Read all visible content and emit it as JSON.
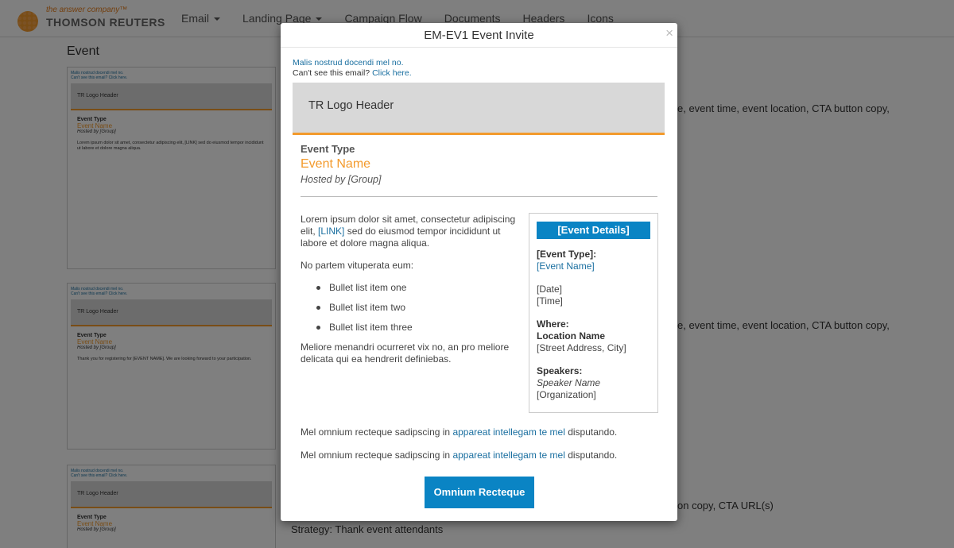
{
  "nav": {
    "logo_tagline": "the answer company™",
    "logo_name": "THOMSON REUTERS",
    "items": [
      {
        "label": "Email",
        "dropdown": true
      },
      {
        "label": "Landing Page",
        "dropdown": true
      },
      {
        "label": "Campaign Flow",
        "dropdown": false
      },
      {
        "label": "Documents",
        "dropdown": false
      },
      {
        "label": "Headers",
        "dropdown": false
      },
      {
        "label": "Icons",
        "dropdown": false
      }
    ]
  },
  "background": {
    "page_title": "Event",
    "side_texts": [
      "e, event time, event location, CTA button copy,",
      "e, event time, event location, CTA button copy,",
      "on copy, CTA URL(s)",
      "Strategy: Thank event attendants"
    ],
    "thumb_preheader_1": "Malis nostrud docendi mel no.",
    "thumb_preheader_2": "Can't see this email? Click here.",
    "thumb_header": "TR Logo Header",
    "thumb_event_type": "Event Type",
    "thumb_event_name": "Event Name",
    "thumb_hosted": "Hosted by [Group]",
    "thumb_body_1": "Lorem ipsum dolor sit amet, consectetur adipiscing elit, [LINK] sed do eiusmod tempor incididunt ut labore et dolore magna aliqua.",
    "thumb_body_2": "Thank you for registering for [EVENT NAME]. We are looking forward to your participation."
  },
  "modal": {
    "title": "EM-EV1 Event Invite",
    "close": "×",
    "preheader_line1": "Malis nostrud docendi mel no.",
    "preheader_line2_text": "Can't see this email? ",
    "preheader_line2_link": "Click here.",
    "logo_header": "TR Logo Header",
    "event_type": "Event Type",
    "event_name": "Event Name",
    "hosted_by": "Hosted by [Group]",
    "body_para1_a": "Lorem ipsum dolor sit amet, consectetur adipiscing elit, ",
    "body_para1_link": "[LINK]",
    "body_para1_b": " sed do eiusmod tempor incididunt ut labore et dolore magna aliqua.",
    "body_para2": "No partem vituperata eum:",
    "bullets": [
      "Bullet list item one",
      "Bullet list item two",
      "Bullet list item three"
    ],
    "body_para3": "Meliore menandri ocurreret vix no, an pro meliore delicata qui ea hendrerit definiebas.",
    "details": {
      "title": "[Event Details]",
      "event_type_label": "[Event Type]:",
      "event_name_link": "[Event Name]",
      "date": "[Date]",
      "time": "[Time]",
      "where_label": "Where:",
      "location_name": "Location Name",
      "street": "[Street Address, City]",
      "speakers_label": "Speakers:",
      "speaker_name": "Speaker Name",
      "organization": "[Organization]"
    },
    "footnote_a": "Mel omnium recteque sadipscing in ",
    "footnote_link": "appareat intellegam te mel",
    "footnote_b": " disputando.",
    "cta_label": "Omnium Recteque"
  },
  "colors": {
    "accent_orange": "#f39a2c",
    "link_blue": "#1a6fa0",
    "button_blue": "#0a84c4"
  }
}
